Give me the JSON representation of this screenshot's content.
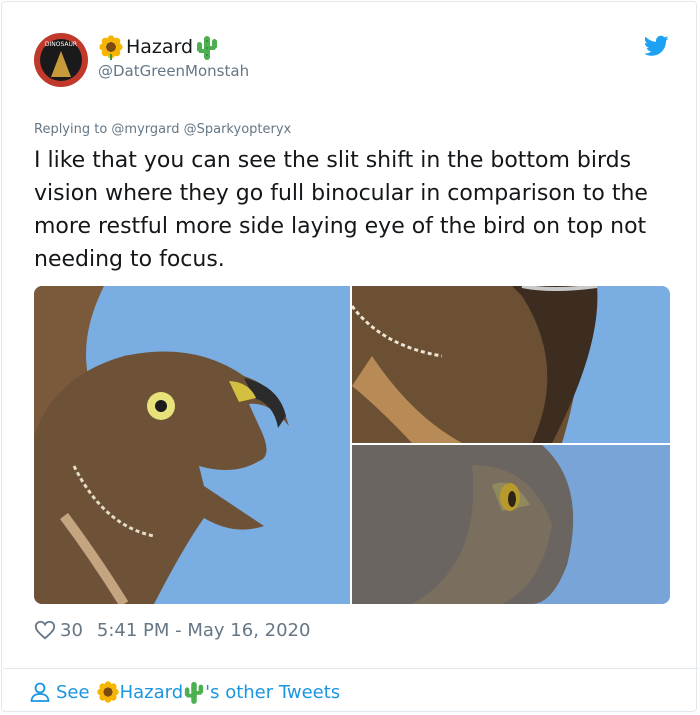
{
  "author": {
    "display_name": "Hazard",
    "handle": "@DatGreenMonstah",
    "avatar_text": "DINOSAUR"
  },
  "tweet": {
    "replying_to": "Replying to @myrgard @Sparkyopteryx",
    "text": "I like that you can see the slit shift in the bottom birds vision where they go full binocular in comparison to the more restful more side laying eye of the bird on top not needing to focus.",
    "like_count": "30",
    "timestamp": "5:41 PM - May 16, 2020"
  },
  "footer": {
    "see_label": "See",
    "name": "Hazard",
    "suffix": "'s other Tweets"
  },
  "colors": {
    "link_blue": "#1b95e0",
    "twitter_blue": "#1da1f2",
    "muted": "#657786",
    "text": "#14171a",
    "sky": "#7aaee2"
  },
  "icons": {
    "brand": "twitter-bird-icon",
    "name_left": "sunflower-icon",
    "name_right": "cactus-icon",
    "like": "heart-icon",
    "profile": "person-icon"
  }
}
